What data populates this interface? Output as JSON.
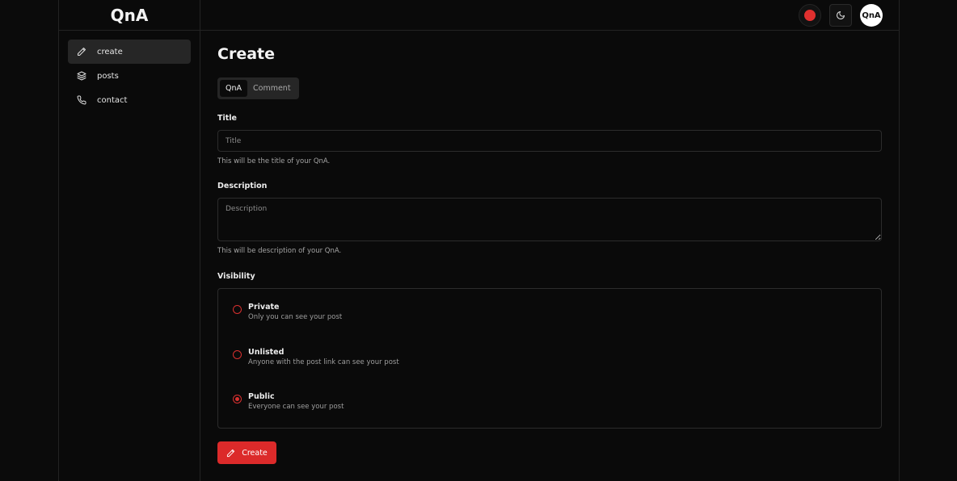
{
  "header": {
    "brand": "QnA",
    "avatar_text": "QnA"
  },
  "sidebar": {
    "items": [
      {
        "label": "create",
        "icon": "pencil-icon",
        "active": true
      },
      {
        "label": "posts",
        "icon": "layers-icon"
      },
      {
        "label": "contact",
        "icon": "phone-icon"
      }
    ]
  },
  "main": {
    "title": "Create",
    "tabs": [
      {
        "label": "QnA",
        "active": true
      },
      {
        "label": "Comment"
      }
    ],
    "title_field": {
      "label": "Title",
      "placeholder": "Title",
      "value": "",
      "hint": "This will be the title of your QnA."
    },
    "description_field": {
      "label": "Description",
      "placeholder": "Description",
      "value": "",
      "hint": "This will be description of your QnA."
    },
    "visibility": {
      "label": "Visibility",
      "options": [
        {
          "title": "Private",
          "desc": "Only you can see your post",
          "checked": false
        },
        {
          "title": "Unlisted",
          "desc": "Anyone with the post link can see your post",
          "checked": false
        },
        {
          "title": "Public",
          "desc": "Everyone can see your post",
          "checked": true
        }
      ]
    },
    "submit_label": "Create"
  },
  "colors": {
    "accent": "#dc2a2a",
    "background": "#0a0a0a",
    "border": "#2c2c2c"
  }
}
